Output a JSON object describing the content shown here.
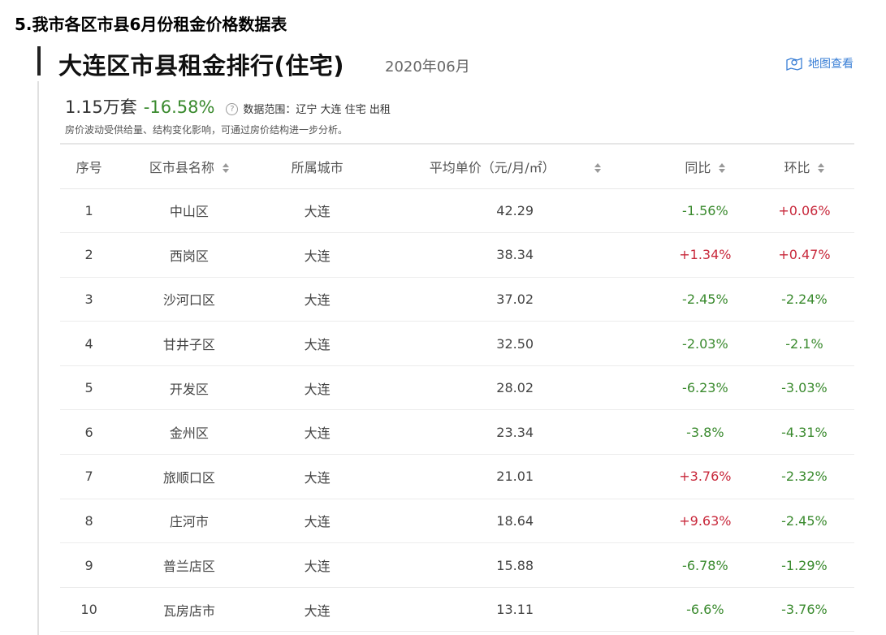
{
  "section_title": "5.我市各区市县6月份租金价格数据表",
  "card": {
    "title": "大连区市县租金排行(住宅)",
    "date": "2020年06月",
    "map_link": "地图查看",
    "count": "1.15万套",
    "change": "-16.58%",
    "help_icon": "?",
    "scope": "数据范围：辽宁  大连  住宅  出租",
    "note": "房价波动受供给量、结构变化影响，可通过房价结构进一步分析。"
  },
  "table": {
    "headers": {
      "index": "序号",
      "name": "区市县名称",
      "city": "所属城市",
      "price": "平均单价（元/月/㎡）",
      "yoy": "同比",
      "mom": "环比"
    },
    "rows": [
      {
        "index": "1",
        "name": "中山区",
        "city": "大连",
        "price": "42.29",
        "yoy": "-1.56%",
        "mom": "+0.06%"
      },
      {
        "index": "2",
        "name": "西岗区",
        "city": "大连",
        "price": "38.34",
        "yoy": "+1.34%",
        "mom": "+0.47%"
      },
      {
        "index": "3",
        "name": "沙河口区",
        "city": "大连",
        "price": "37.02",
        "yoy": "-2.45%",
        "mom": "-2.24%"
      },
      {
        "index": "4",
        "name": "甘井子区",
        "city": "大连",
        "price": "32.50",
        "yoy": "-2.03%",
        "mom": "-2.1%"
      },
      {
        "index": "5",
        "name": "开发区",
        "city": "大连",
        "price": "28.02",
        "yoy": "-6.23%",
        "mom": "-3.03%"
      },
      {
        "index": "6",
        "name": "金州区",
        "city": "大连",
        "price": "23.34",
        "yoy": "-3.8%",
        "mom": "-4.31%"
      },
      {
        "index": "7",
        "name": "旅顺口区",
        "city": "大连",
        "price": "21.01",
        "yoy": "+3.76%",
        "mom": "-2.32%"
      },
      {
        "index": "8",
        "name": "庄河市",
        "city": "大连",
        "price": "18.64",
        "yoy": "+9.63%",
        "mom": "-2.45%"
      },
      {
        "index": "9",
        "name": "普兰店区",
        "city": "大连",
        "price": "15.88",
        "yoy": "-6.78%",
        "mom": "-1.29%"
      },
      {
        "index": "10",
        "name": "瓦房店市",
        "city": "大连",
        "price": "13.11",
        "yoy": "-6.6%",
        "mom": "-3.76%"
      }
    ]
  },
  "colors": {
    "positive": "#c8283b",
    "negative": "#3a8a2e",
    "link": "#3a7fd6"
  }
}
